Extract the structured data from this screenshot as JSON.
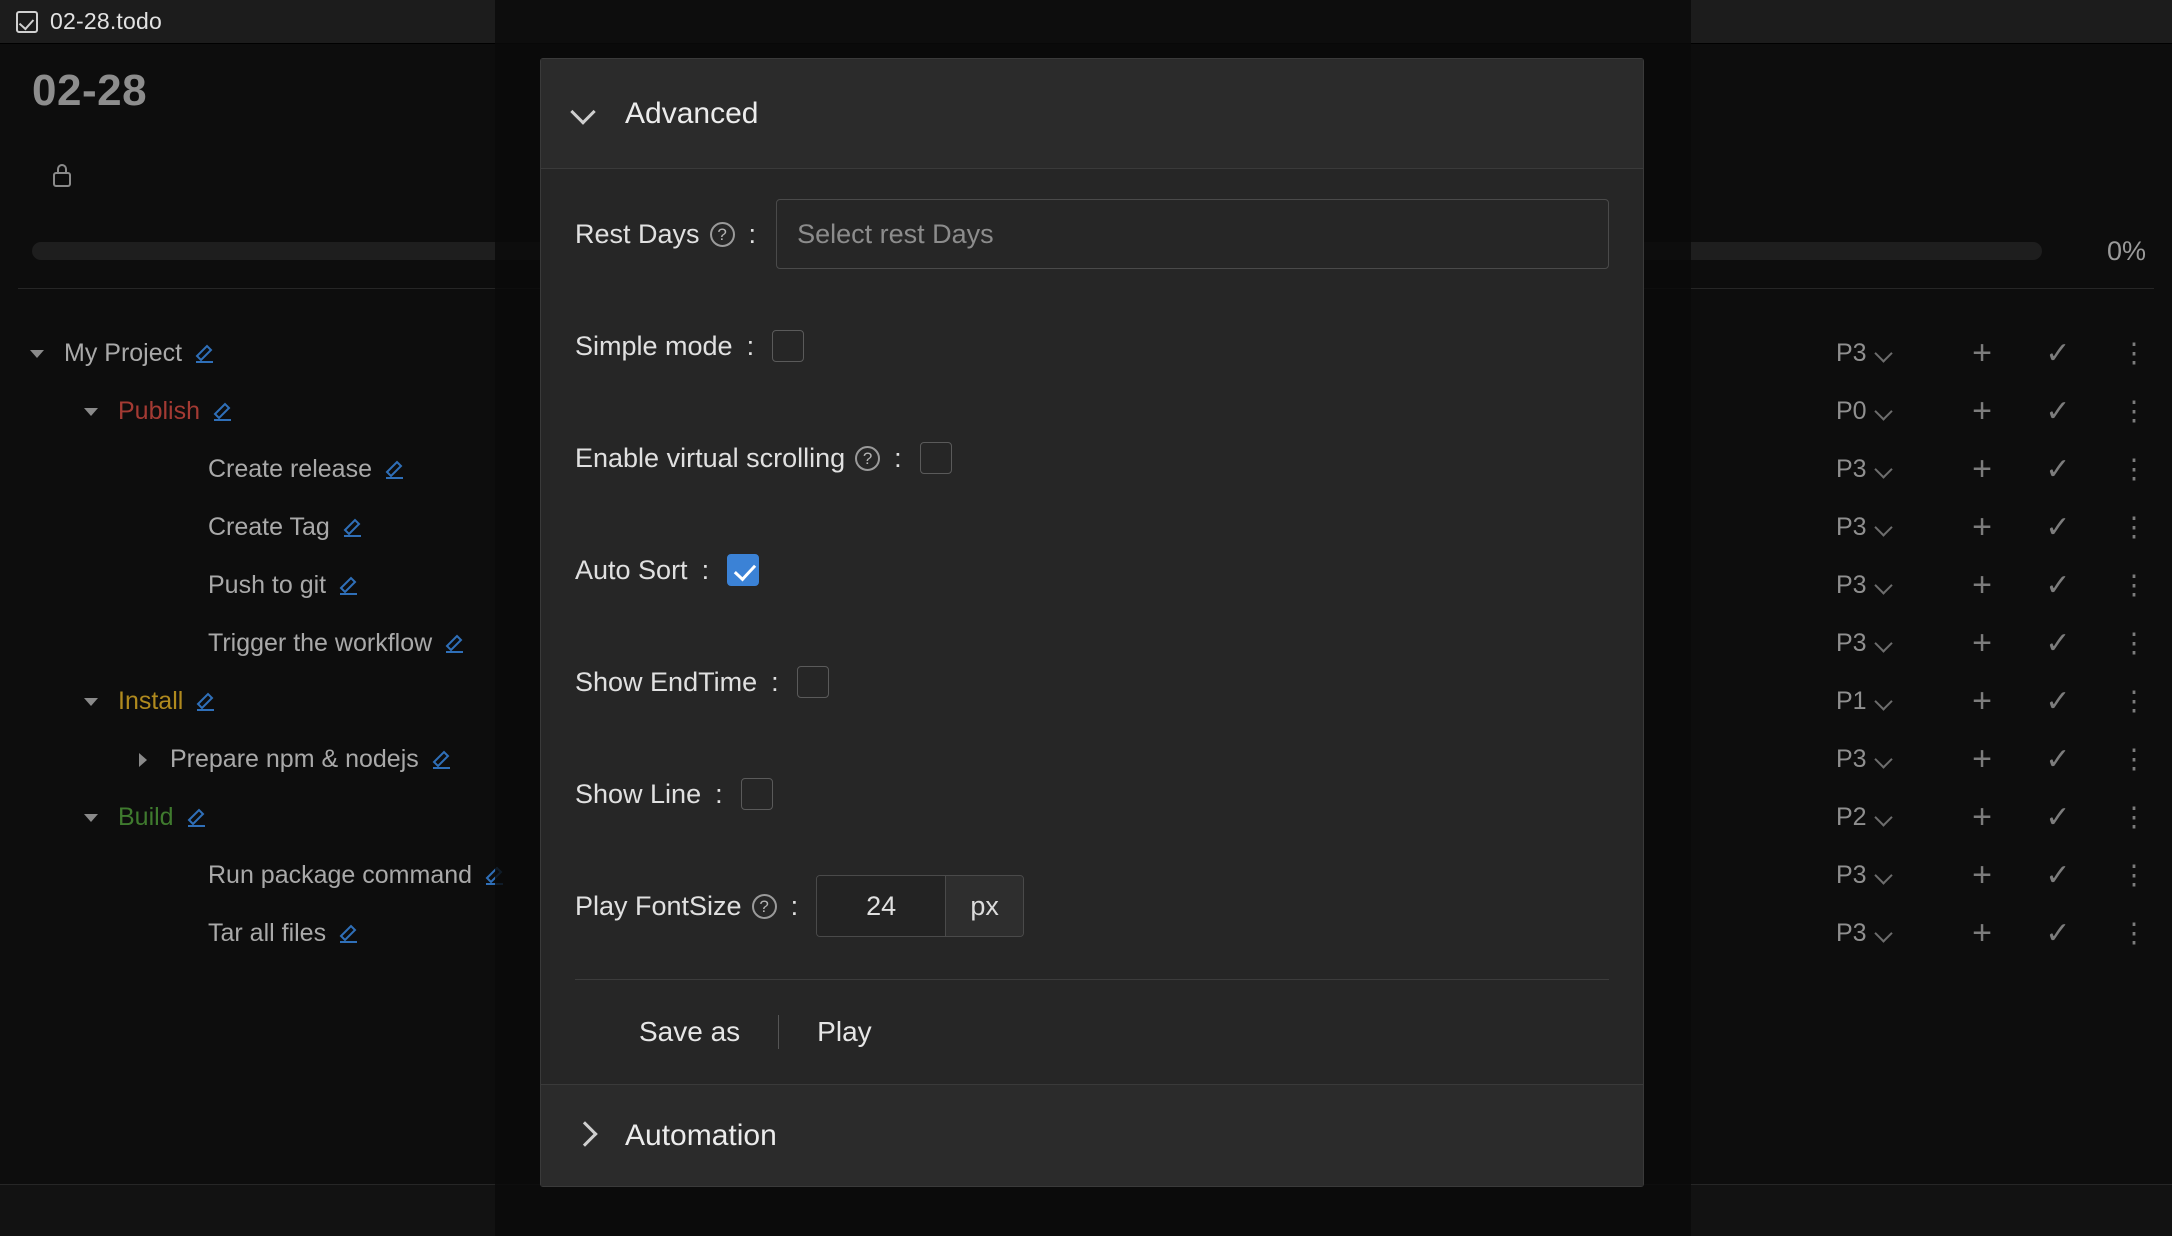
{
  "titlebar": {
    "file_name": "02-28.todo",
    "file_icon": "checkbox-checked-icon"
  },
  "editor": {
    "doc_title": "02-28",
    "lock_icon": "lock-icon",
    "progress": {
      "percent_label": "0%",
      "value": 0
    }
  },
  "tree": {
    "rows": [
      {
        "label": "My Project",
        "indent": 28,
        "caret": "down",
        "color": "default",
        "priority": "P3"
      },
      {
        "label": "Publish",
        "indent": 82,
        "caret": "down",
        "color": "red",
        "priority": "P0"
      },
      {
        "label": "Create release",
        "indent": 172,
        "caret": "none",
        "color": "default",
        "priority": "P3"
      },
      {
        "label": "Create Tag",
        "indent": 172,
        "caret": "none",
        "color": "default",
        "priority": "P3"
      },
      {
        "label": "Push to git",
        "indent": 172,
        "caret": "none",
        "color": "default",
        "priority": "P3"
      },
      {
        "label": "Trigger the workflow",
        "indent": 172,
        "caret": "none",
        "color": "default",
        "priority": "P3"
      },
      {
        "label": "Install",
        "indent": 82,
        "caret": "down",
        "color": "gold",
        "priority": "P1"
      },
      {
        "label": "Prepare npm & nodejs",
        "indent": 134,
        "caret": "right",
        "color": "default",
        "priority": "P3"
      },
      {
        "label": "Build",
        "indent": 82,
        "caret": "down",
        "color": "green",
        "priority": "P2"
      },
      {
        "label": "Run package command",
        "indent": 172,
        "caret": "none",
        "color": "default",
        "priority": "P3"
      },
      {
        "label": "Tar all files",
        "indent": 172,
        "caret": "none",
        "color": "default",
        "priority": "P3"
      }
    ],
    "row_icons": {
      "edit": "pencil-icon",
      "priority_chevron": "chevron-down-icon",
      "add": "plus-icon",
      "complete": "check-icon",
      "more": "more-vertical-icon"
    }
  },
  "modal": {
    "advanced": {
      "title": "Advanced",
      "chevron": "chevron-down-icon",
      "fields": {
        "rest_days": {
          "label": "Rest Days",
          "help_icon": "question-circle-icon",
          "placeholder": "Select rest Days",
          "value": ""
        },
        "simple_mode": {
          "label": "Simple mode",
          "checked": false
        },
        "enable_virtual_scrolling": {
          "label": "Enable virtual scrolling",
          "help_icon": "question-circle-icon",
          "checked": false
        },
        "auto_sort": {
          "label": "Auto Sort",
          "checked": true
        },
        "show_endtime": {
          "label": "Show EndTime",
          "checked": false
        },
        "show_line": {
          "label": "Show Line",
          "checked": false
        },
        "play_fontsize": {
          "label": "Play FontSize",
          "help_icon": "question-circle-icon",
          "value": "24",
          "unit": "px"
        }
      },
      "actions": {
        "save_as": "Save as",
        "play": "Play"
      }
    },
    "automation": {
      "title": "Automation",
      "chevron": "chevron-right-icon"
    }
  },
  "colors": {
    "accent": "#3b82d6",
    "panel_bg": "#262626",
    "panel_header_bg": "#2b2b2b",
    "editor_bg": "#0d0d0d",
    "node_red": "#a33a33",
    "node_gold": "#b08a1e",
    "node_green": "#3f7a2e"
  }
}
